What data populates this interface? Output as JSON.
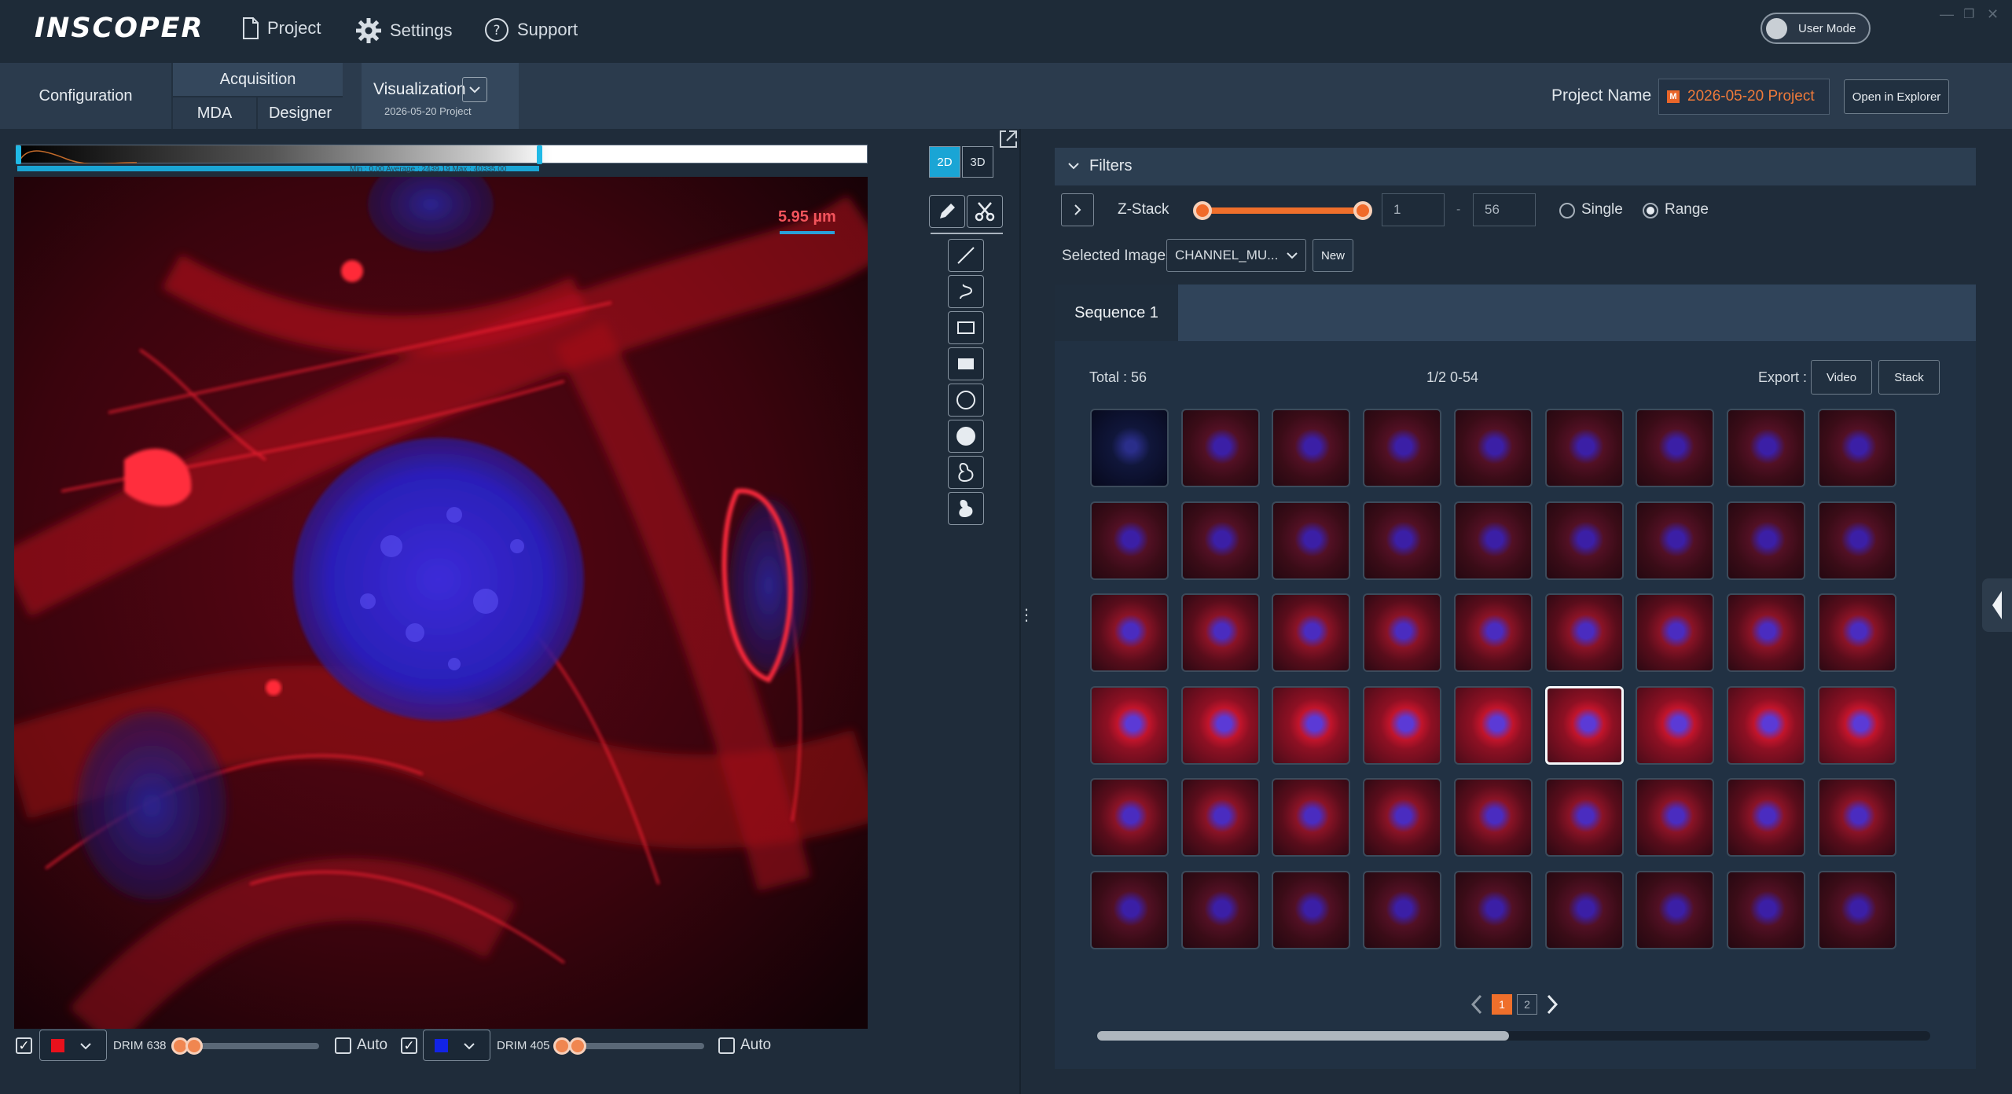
{
  "app": {
    "logo": "INSCOPER"
  },
  "topnav": {
    "project": "Project",
    "settings": "Settings",
    "support": "Support"
  },
  "user_mode": "User Mode",
  "tabs": {
    "configuration": "Configuration",
    "acquisition": "Acquisition",
    "mda": "MDA",
    "designer": "Designer",
    "visualization": "Visualization",
    "visualization_sub": "2026-05-20 Project"
  },
  "project": {
    "label": "Project Name",
    "name": "2026-05-20 Project",
    "open_label": "Open in Explorer"
  },
  "viewer": {
    "colormap_stats": "Min : 0.00 Average : 2439.19 Max : 40335.00",
    "scale_label": "5.95 µm",
    "mode_2d": "2D",
    "mode_3d": "3D"
  },
  "channels": [
    {
      "name": "DRIM 638",
      "color": "#e8111c",
      "checked": true,
      "auto_label": "Auto",
      "auto": false
    },
    {
      "name": "DRIM 405",
      "color": "#1223e6",
      "checked": true,
      "auto_label": "Auto",
      "auto": false
    }
  ],
  "tools": [
    "pencil-icon",
    "scissors-icon",
    "line-icon",
    "freehand-icon",
    "rectangle-icon",
    "filled-rectangle-icon",
    "circle-icon",
    "filled-circle-icon",
    "polygon-icon",
    "filled-polygon-icon"
  ],
  "filters": {
    "title": "Filters",
    "zstack_label": "Z-Stack",
    "zstack_from": "1",
    "zstack_sep": "-",
    "zstack_to": "56",
    "single_label": "Single",
    "range_label": "Range",
    "mode": "Range",
    "selected_images_label": "Selected Images",
    "selected_images_value": "CHANNEL_MU...",
    "new_label": "New"
  },
  "sequence": {
    "tab": "Sequence 1",
    "total": "Total : 56",
    "position": "1/2 0-54",
    "export_label": "Export :",
    "video_label": "Video",
    "stack_label": "Stack",
    "pages": [
      "1",
      "2"
    ],
    "current_page": "1",
    "thumbnail_count": 54,
    "selected_thumbnail_index": 32
  },
  "colors": {
    "accent": "#1aa5d5",
    "orange": "#ef6f2b",
    "background": "#1f2c3a"
  }
}
